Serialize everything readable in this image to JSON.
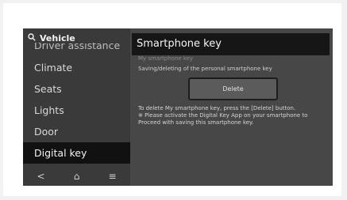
{
  "sidebar": {
    "search_label": "Vehicle",
    "items": [
      {
        "label": "Driver assistance"
      },
      {
        "label": "Climate"
      },
      {
        "label": "Seats"
      },
      {
        "label": "Lights"
      },
      {
        "label": "Door"
      },
      {
        "label": "Digital key"
      }
    ],
    "bottom": {
      "back": "<",
      "home": "⌂",
      "menu": "≡"
    }
  },
  "pane": {
    "title": "Smartphone key",
    "ghost_heading": "My smartphone key",
    "description": "Saving/deleting of the personal smartphone key",
    "delete_label": "Delete",
    "note_line1": "To delete My smartphone key, press the [Delete] button.",
    "note_line2": "※ Please activate the Digital Key App on your smartphone to",
    "note_line3": "Proceed with saving this smartphone key."
  },
  "colors": {
    "screen_bg": "#3f3f3f",
    "active_item_bg": "#111111",
    "title_bar_bg": "#161616"
  }
}
